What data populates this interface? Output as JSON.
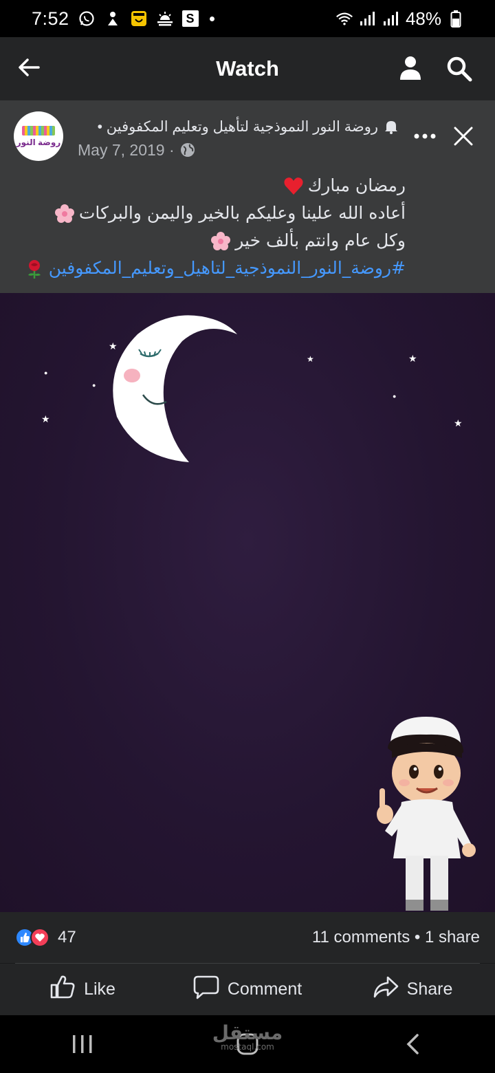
{
  "status_bar": {
    "time": "7:52",
    "battery": "48%",
    "icons": [
      "whatsapp-icon",
      "notification-icon",
      "calendar-icon",
      "weather-icon",
      "s-app-icon",
      "wifi-icon",
      "signal-icon",
      "battery-icon"
    ],
    "s_label": "S"
  },
  "header": {
    "title": "Watch",
    "icons": [
      "back-arrow-icon",
      "profile-icon",
      "search-icon"
    ]
  },
  "post": {
    "page_name": "روضة النور النموذجية لتأهيل وتعليم المكفوفين •",
    "avatar_text": "روضة النور",
    "date": "May 7, 2019 ·",
    "text_lines": [
      "رمضان مبارك",
      "أعاده الله علينا وعليكم بالخير واليمن والبركات",
      "وكل عام وانتم بألف خير"
    ],
    "hashtag": "#روضة_النور_النموذجية_لتاهيل_وتعليم_المكفوفين"
  },
  "reactions": {
    "count": "47",
    "stats": "11 comments • 1 share"
  },
  "actions": {
    "like": "Like",
    "comment": "Comment",
    "share": "Share"
  },
  "colors": {
    "background": "#18191a",
    "header": "#242526",
    "post_header": "#3a3b3c",
    "accent": "#2d88ff",
    "hashtag": "#4599ff",
    "love": "#f33e58"
  },
  "watermark": {
    "text": "مستقل",
    "sub": "mostaql.com"
  }
}
